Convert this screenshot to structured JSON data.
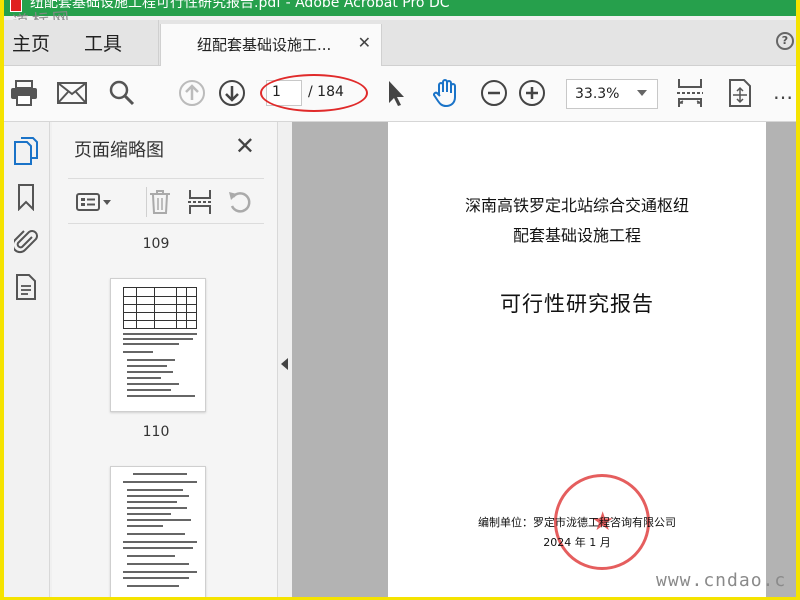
{
  "window": {
    "title": "纽配套基础设施工程可行性研究报告.pdf - Adobe Acrobat Pro DC",
    "watermark_top": "道标网",
    "watermark_bottom": "www.cndao.c"
  },
  "menu": {
    "home": "主页",
    "tools": "工具",
    "doc_tab": "纽配套基础设施工...",
    "help": "?"
  },
  "toolbar": {
    "icons": [
      "print-icon",
      "email-icon",
      "search-icon",
      "page-up-icon",
      "page-down-icon",
      "select-arrow-icon",
      "hand-icon",
      "zoom-out-icon",
      "zoom-in-icon",
      "fit-width-icon",
      "fit-page-icon"
    ],
    "current_page": "1",
    "total_pages": "/ 184",
    "zoom": "33.3%",
    "more": "…"
  },
  "rail": {
    "icons": [
      "page-thumbnails-icon",
      "bookmark-icon",
      "attachment-icon",
      "document-properties-icon"
    ]
  },
  "thumbnails_panel": {
    "title": "页面缩略图",
    "page_labels": [
      "109",
      "110"
    ],
    "accent_color": "#1a73c8"
  },
  "document": {
    "title_line1": "深南高铁罗定北站综合交通枢纽",
    "title_line2": "配套基础设施工程",
    "main_title": "可行性研究报告",
    "org": "编制单位：罗定市泷德工程咨询有限公司",
    "date": "2024 年 1 月"
  },
  "colors": {
    "frame_border": "#f5e300",
    "title_bar": "#26a04c",
    "annotation": "#e02a2a"
  }
}
